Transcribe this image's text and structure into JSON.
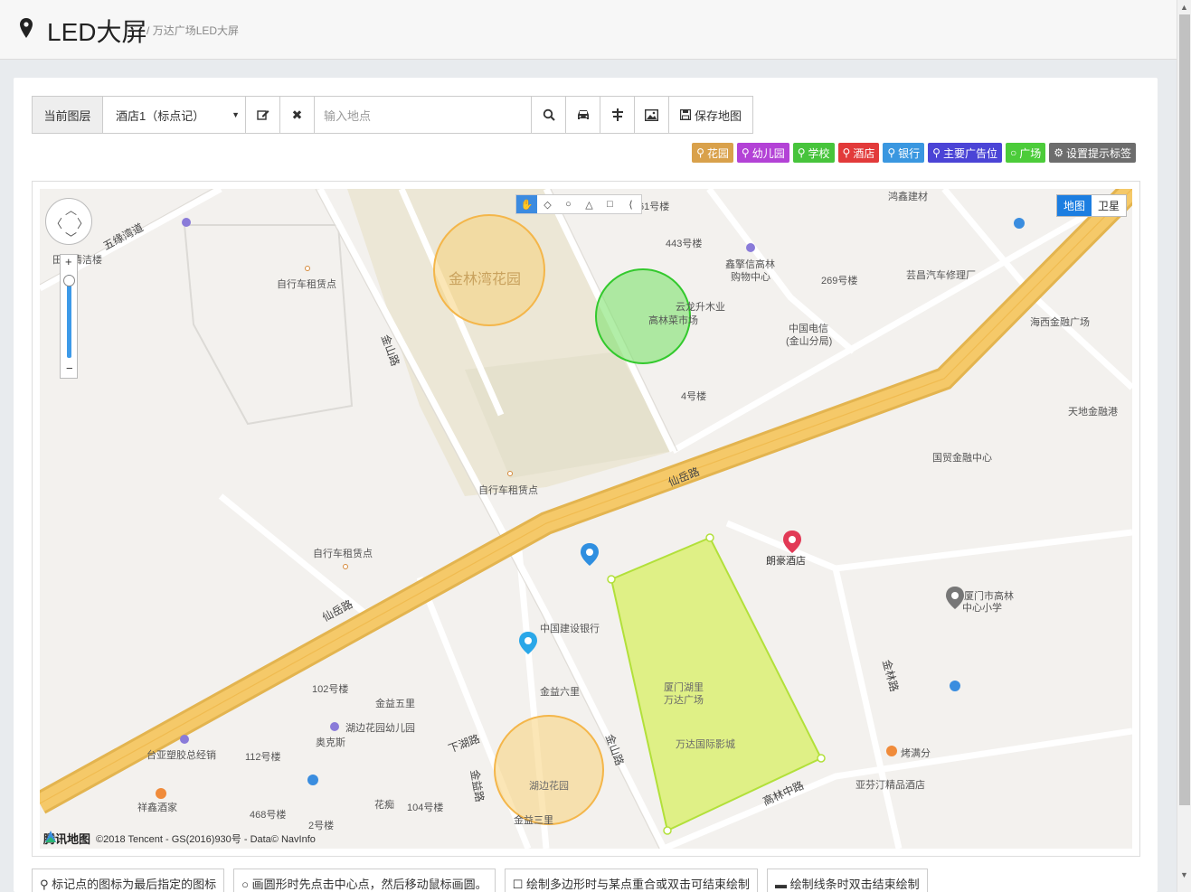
{
  "header": {
    "title": "LED大屏",
    "separator": "/",
    "subtitle": "万达广场LED大屏"
  },
  "toolbar": {
    "layer_label": "当前图层",
    "layer_value": "酒店1（标点记）",
    "edit_icon": "edit-icon",
    "delete_icon": "close-icon",
    "search_placeholder": "输入地点",
    "search_icon": "search-icon",
    "car_icon": "car-icon",
    "road_icon": "road-icon",
    "image_icon": "image-icon",
    "save_label": "保存地图"
  },
  "tags": [
    {
      "label": "花园",
      "color": "#d9a14b",
      "icon": "pin-icon"
    },
    {
      "label": "幼儿园",
      "color": "#b342d6",
      "icon": "pin-icon"
    },
    {
      "label": "学校",
      "color": "#47c43c",
      "icon": "pin-icon"
    },
    {
      "label": "酒店",
      "color": "#e23a3a",
      "icon": "pin-icon"
    },
    {
      "label": "银行",
      "color": "#3a97e0",
      "icon": "pin-icon"
    },
    {
      "label": "主要广告位",
      "color": "#4b44d6",
      "icon": "pin-icon"
    },
    {
      "label": "广场",
      "color": "#4ccc3a",
      "icon": "circle-icon"
    },
    {
      "label": "设置提示标签",
      "color": "#6d6d6d",
      "icon": "gear-icon"
    }
  ],
  "map": {
    "type_map": "地图",
    "type_satellite": "卫星",
    "labels": {
      "wuyuan": "五缘湾道",
      "tianshang": "田厝清洁楼",
      "bike1": "自行车租赁点",
      "bike2": "自行车租赁点",
      "bike3": "自行车租赁点",
      "jinshan1": "金山路",
      "jinshan2": "金山路",
      "jinlinwan": "金林湾花园",
      "yunlong": "云龙升木业",
      "gaolin_market": "高林菜市场",
      "b443": "443号楼",
      "b61": "61号楼",
      "xinqing": "鑫擎信高林",
      "xinqing2": "购物中心",
      "b269": "269号楼",
      "hongxin": "鸿鑫建材",
      "yunchang": "芸昌汽车修理厂",
      "haixi": "海西金融广场",
      "telecom": "中国电信",
      "telecom2": "(金山分局)",
      "b4": "4号楼",
      "tiandi": "天地金融港",
      "guomao": "国贸金融中心",
      "xianyue1": "仙岳路",
      "xianyue2": "仙岳路",
      "langhao": "朗豪酒店",
      "gaolin_school": "厦门市高林",
      "gaolin_school2": "中心小学",
      "ccb": "中国建设银行",
      "wanda1": "厦门湖里",
      "wanda2": "万达广场",
      "wanda_cinema": "万达国际影城",
      "b102": "102号楼",
      "jinyi5": "金益五里",
      "jinyi6": "金益六里",
      "hubian_kg": "湖边花园幼儿园",
      "aokesi": "奥克斯",
      "taiya": "台亚塑胶总经销",
      "b112": "112号楼",
      "xiahu": "下湖路",
      "jinyi_road": "金益路",
      "hubian_garden": "湖边花园",
      "xiangxin": "祥鑫酒家",
      "b468": "468号楼",
      "b2": "2号楼",
      "huadian": "花痴",
      "b104": "104号楼",
      "jinyi3": "金益三里",
      "jinlin_road": "金林路",
      "kaomanfen": "烤满分",
      "yafenting": "亚芬汀精品酒店",
      "gaolinzhong": "高林中路"
    },
    "copyright_logo": "腾讯地图",
    "copyright_text": "©2018 Tencent - GS(2016)930号 - Data© NavInfo"
  },
  "hints": [
    "标记点的图标为最后指定的图标",
    "画圆形时先点击中心点，然后移动鼠标画圆。",
    "绘制多边形时与某点重合或双击可结束绘制",
    "绘制线条时双击结束绘制"
  ]
}
